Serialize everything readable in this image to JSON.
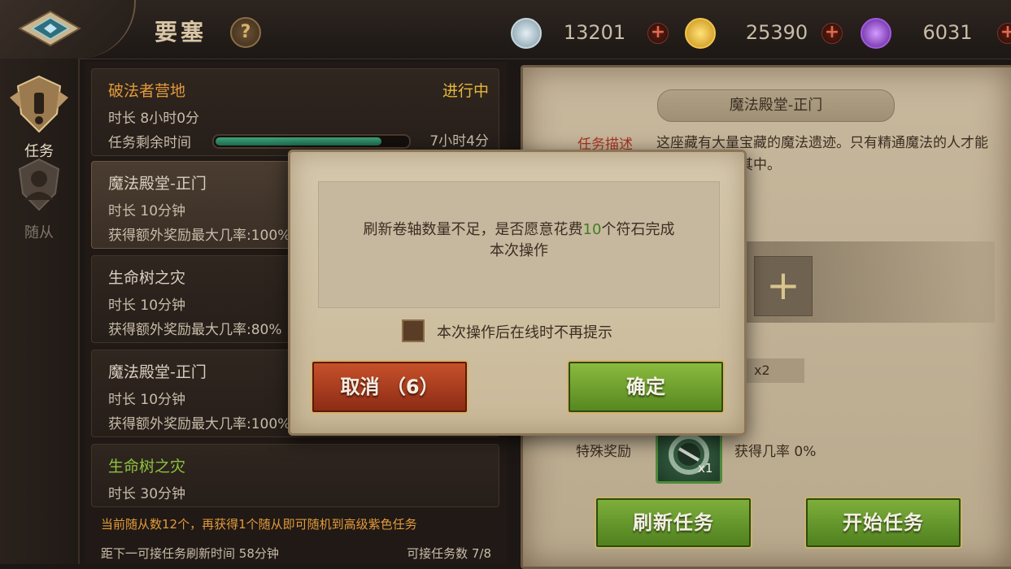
{
  "header": {
    "title": "要塞",
    "help_symbol": "?",
    "resources": [
      {
        "icon": "silver-coin-icon",
        "value": "13201",
        "color": "#9fb8c8"
      },
      {
        "icon": "gold-coin-icon",
        "value": "25390",
        "color": "#e7b32a"
      },
      {
        "icon": "purple-rune-icon",
        "value": "6031",
        "color": "#8a3fd0"
      }
    ],
    "plus_symbol": "+"
  },
  "leftnav": {
    "items": [
      {
        "label": "任务",
        "icon": "quest-shield-icon",
        "active": true
      },
      {
        "label": "随从",
        "icon": "follower-icon",
        "active": false
      }
    ]
  },
  "missions": [
    {
      "name": "破法者营地",
      "status": "进行中",
      "duration": "时长 8小时0分",
      "remaining_label": "任务剩余时间",
      "remaining": "7小时4分",
      "progress": 0.88
    },
    {
      "name": "魔法殿堂-正门",
      "line2": "时长 10分钟",
      "line3": "获得额外奖励最大几率:100%"
    },
    {
      "name": "生命树之灾",
      "line2": "时长 10分钟",
      "line3": "获得额外奖励最大几率:80%"
    },
    {
      "name": "魔法殿堂-正门",
      "line2": "时长 10分钟",
      "line3": "获得额外奖励最大几率:100%"
    },
    {
      "name": "生命树之灾",
      "line2": "时长 30分钟"
    }
  ],
  "list_footer": {
    "note": "当前随从数12个，再获得1个随从即可随机到高级紫色任务",
    "refresh_time": "距下一可接任务刷新时间 58分钟",
    "available": "可接任务数 7/8"
  },
  "detail": {
    "title": "魔法殿堂-正门",
    "desc_label": "任务描述",
    "desc_text": "这座藏有大量宝藏的魔法遗迹。只有精通魔法的人才能避开危险进入其中。",
    "slot_plus": "+",
    "multiplier": "x2",
    "special_label": "特殊奖励",
    "special_count": "x1",
    "chance": "获得几率 0%",
    "refresh_button": "刷新任务",
    "start_button": "开始任务"
  },
  "dialog": {
    "message_part1": "刷新卷轴数量不足，是否愿意花费",
    "message_highlight": "10",
    "message_part2": "个符石完成",
    "message_line2": "本次操作",
    "checkbox_label": "本次操作后在线时不再提示",
    "cancel_label": "取消 （6）",
    "ok_label": "确定"
  }
}
